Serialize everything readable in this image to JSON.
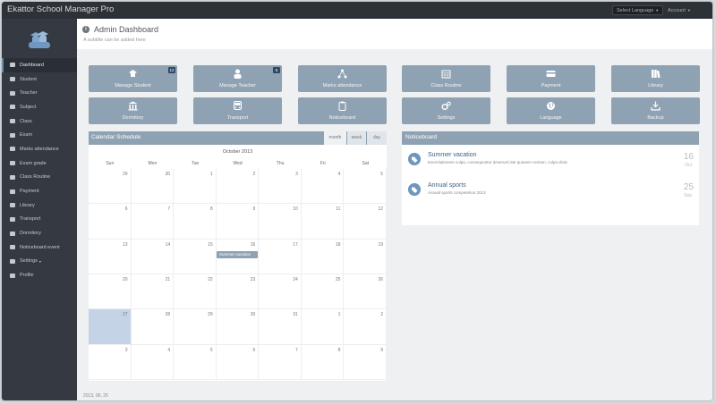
{
  "app": {
    "title": "Ekattor School Manager Pro",
    "language_label": "Select Language",
    "account_label": "Account"
  },
  "sidebar": {
    "items": [
      {
        "label": "Dashboard",
        "icon": "dashboard-icon",
        "active": true
      },
      {
        "label": "Student",
        "icon": "user-icon"
      },
      {
        "label": "Teacher",
        "icon": "teacher-icon"
      },
      {
        "label": "Subject",
        "icon": "bookmark-icon"
      },
      {
        "label": "Class",
        "icon": "class-icon"
      },
      {
        "label": "Exam",
        "icon": "pencil-icon"
      },
      {
        "label": "Marks attendance",
        "icon": "network-icon"
      },
      {
        "label": "Exam grade",
        "icon": "list-icon"
      },
      {
        "label": "Class Routine",
        "icon": "routine-icon"
      },
      {
        "label": "Payment",
        "icon": "credit-card-icon"
      },
      {
        "label": "Library",
        "icon": "book-icon"
      },
      {
        "label": "Transport",
        "icon": "bus-icon"
      },
      {
        "label": "Dormitory",
        "icon": "building-icon"
      },
      {
        "label": "Noticeboard event",
        "icon": "clipboard-icon"
      },
      {
        "label": "Settings",
        "icon": "gears-icon",
        "caret": "▾"
      },
      {
        "label": "Profile",
        "icon": "wrench-icon"
      }
    ]
  },
  "header": {
    "title": "Admin Dashboard",
    "subtitle": "A subtitle can be added here"
  },
  "tiles": [
    {
      "label": "Manage Student",
      "icon": "graduate-icon",
      "badge": "12"
    },
    {
      "label": "Manage Teacher",
      "icon": "user-icon",
      "badge": "5"
    },
    {
      "label": "Marks attendance",
      "icon": "network-icon"
    },
    {
      "label": "Class Routine",
      "icon": "calendar-icon"
    },
    {
      "label": "Payment",
      "icon": "credit-card-icon"
    },
    {
      "label": "Library",
      "icon": "books-icon"
    },
    {
      "label": "Dormitory",
      "icon": "building-icon"
    },
    {
      "label": "Transport",
      "icon": "bus-icon"
    },
    {
      "label": "Noticeboard",
      "icon": "clipboard-icon"
    },
    {
      "label": "Settings",
      "icon": "gears-icon"
    },
    {
      "label": "Language",
      "icon": "globe-icon"
    },
    {
      "label": "Backup",
      "icon": "download-icon"
    }
  ],
  "calendar": {
    "title": "Calendar Schedule",
    "views": [
      "month",
      "week",
      "day"
    ],
    "month_title": "October 2013",
    "weekdays": [
      "Sun",
      "Mon",
      "Tue",
      "Wed",
      "Thu",
      "Fri",
      "Sat"
    ],
    "days": [
      "29",
      "30",
      "1",
      "2",
      "3",
      "4",
      "5",
      "6",
      "7",
      "8",
      "9",
      "10",
      "11",
      "12",
      "13",
      "14",
      "15",
      "16",
      "17",
      "18",
      "19",
      "20",
      "21",
      "22",
      "23",
      "24",
      "25",
      "26",
      "27",
      "28",
      "29",
      "30",
      "31",
      "1",
      "2",
      "3",
      "4",
      "5",
      "6",
      "7",
      "8",
      "9"
    ],
    "today_index": 28,
    "event": {
      "label": "Summer vacation"
    }
  },
  "noticeboard": {
    "title": "Noticeboard",
    "items": [
      {
        "title": "Summer vacation",
        "description": "Exercitationem culpa, consequuntur deserunt iste quasem veniam, culpa dicta",
        "day": "16",
        "month": "Oct"
      },
      {
        "title": "Annual sports",
        "description": "Annual sports competetion 2013",
        "day": "25",
        "month": "Sep"
      }
    ]
  },
  "footer": {
    "text": "2013, 06, 25"
  },
  "colors": {
    "tile": "#8fa2b3",
    "sidebar": "#353a42",
    "topbar": "#2d3138",
    "accent": "#6f97bd"
  }
}
